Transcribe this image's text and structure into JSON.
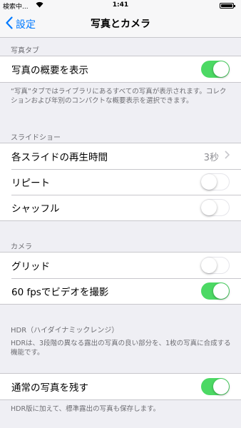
{
  "status": {
    "carrier": "検索中...",
    "time": "1:41"
  },
  "nav": {
    "back_label": "設定",
    "title": "写真とカメラ"
  },
  "sections": {
    "photos_tab": {
      "header": "写真タブ",
      "summary_label": "写真の概要を表示",
      "summary_on": true,
      "footer": "“写真”タブではライブラリにあるすべての写真が表示されます。コレクションおよび年別のコンパクトな概要表示を選択できます。"
    },
    "slideshow": {
      "header": "スライドショー",
      "duration_label": "各スライドの再生時間",
      "duration_value": "3秒",
      "repeat_label": "リピート",
      "repeat_on": false,
      "shuffle_label": "シャッフル",
      "shuffle_on": false
    },
    "camera": {
      "header": "カメラ",
      "grid_label": "グリッド",
      "grid_on": false,
      "fps_label": "60 fpsでビデオを撮影",
      "fps_on": true
    },
    "hdr": {
      "header": "HDR（ハイダイナミックレンジ）",
      "description": "HDRは、3段階の異なる露出の写真の良い部分を、1枚の写真に合成する機能です。",
      "keep_label": "通常の写真を残す",
      "keep_on": true,
      "footer": "HDR版に加えて、標準露出の写真も保存します。"
    }
  },
  "colors": {
    "accent": "#007aff",
    "toggle_on": "#4cd964",
    "background": "#efeff4"
  }
}
